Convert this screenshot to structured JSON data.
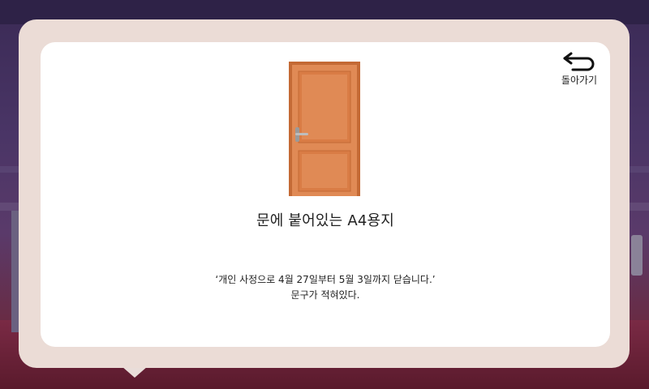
{
  "item": {
    "title": "문에 붙어있는 A4용지",
    "description_line1": "‘개인 사정으로 4월 27일부터 5월 3일까지 닫습니다.’",
    "description_line2": "문구가 적혀있다.",
    "image_icon": "door-icon"
  },
  "back": {
    "label": "돌아가기",
    "icon": "return-arrow-icon"
  },
  "colors": {
    "door": "#e08a55",
    "door_panel": "#d97c45",
    "door_frame": "#c46a35",
    "frame_bg": "#ebdcd6",
    "card_bg": "#ffffff"
  }
}
